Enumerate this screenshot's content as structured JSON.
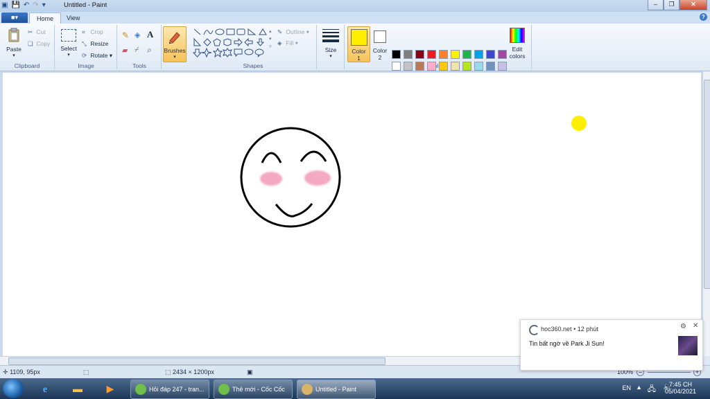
{
  "window": {
    "title": "Untitled - Paint"
  },
  "tabs": {
    "file": "■▾",
    "home": "Home",
    "view": "View"
  },
  "clipboard": {
    "paste": "Paste",
    "cut": "Cut",
    "copy": "Copy",
    "label": "Clipboard"
  },
  "image": {
    "select": "Select",
    "crop": "Crop",
    "resize": "Resize",
    "rotate": "Rotate",
    "label": "Image"
  },
  "tools": {
    "label": "Tools",
    "text": "A"
  },
  "brushes": {
    "label": "Brushes"
  },
  "shapes": {
    "outline": "Outline",
    "fill": "Fill",
    "label": "Shapes"
  },
  "size": {
    "label": "Size"
  },
  "colors": {
    "color1_label": "Color",
    "color1_num": "1",
    "color2_label": "Color",
    "color2_num": "2",
    "edit_label": "Edit",
    "edit_label2": "colors",
    "label": "Colors",
    "color1": "#ffee00",
    "color2": "#ffffff",
    "row1": [
      "#000000",
      "#7f7f7f",
      "#880015",
      "#ed1c24",
      "#ff7f27",
      "#fff200",
      "#22b14c",
      "#00a2e8",
      "#3f48cc",
      "#a349a4"
    ],
    "row2": [
      "#ffffff",
      "#c3c3c3",
      "#b97a57",
      "#ffaec9",
      "#ffc90e",
      "#efe4b0",
      "#b5e61d",
      "#99d9ea",
      "#7092be",
      "#c8bfe7"
    ]
  },
  "status": {
    "cursor_pos": "1109, 95px",
    "image_size": "2434 × 1200px",
    "zoom": "100%"
  },
  "taskbar": {
    "task1": "Hỏi đáp 247 - tran...",
    "task2": "Thẻ mới - Cốc Cốc",
    "task3": "Untitled - Paint",
    "lang": "EN",
    "time": "7:45 CH",
    "date": "05/04/2021"
  },
  "notification": {
    "source": "hoc360.net",
    "time": "12 phút",
    "message": "Tin bất ngờ về Park Ji Sun!"
  }
}
